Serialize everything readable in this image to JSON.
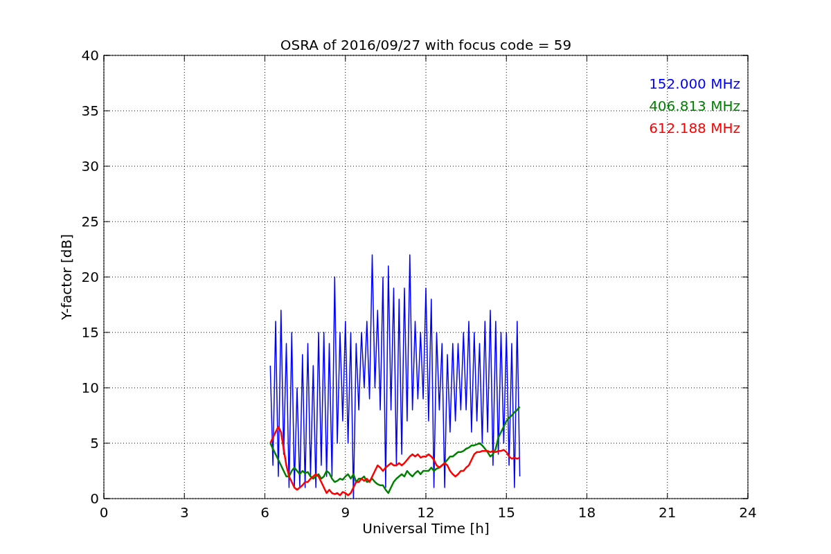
{
  "chart_data": {
    "type": "line",
    "title": "OSRA of 2016/09/27 with focus code = 59",
    "xlabel": "Universal Time [h]",
    "ylabel": "Y-factor [dB]",
    "grid": true,
    "xlim": [
      0,
      24
    ],
    "ylim": [
      0,
      40
    ],
    "xticks": [
      0,
      3,
      6,
      9,
      12,
      15,
      18,
      21,
      24
    ],
    "yticks": [
      0,
      5,
      10,
      15,
      20,
      25,
      30,
      35,
      40
    ],
    "x": [
      6.2,
      6.3,
      6.4,
      6.5,
      6.6,
      6.7,
      6.8,
      6.9,
      7.0,
      7.1,
      7.2,
      7.3,
      7.4,
      7.5,
      7.6,
      7.7,
      7.8,
      7.9,
      8.0,
      8.1,
      8.2,
      8.3,
      8.4,
      8.5,
      8.6,
      8.7,
      8.8,
      8.9,
      9.0,
      9.1,
      9.2,
      9.3,
      9.4,
      9.5,
      9.6,
      9.7,
      9.8,
      9.9,
      10.0,
      10.1,
      10.2,
      10.3,
      10.4,
      10.5,
      10.6,
      10.7,
      10.8,
      10.9,
      11.0,
      11.1,
      11.2,
      11.3,
      11.4,
      11.5,
      11.6,
      11.7,
      11.8,
      11.9,
      12.0,
      12.1,
      12.2,
      12.3,
      12.4,
      12.5,
      12.6,
      12.7,
      12.8,
      12.9,
      13.0,
      13.1,
      13.2,
      13.3,
      13.4,
      13.5,
      13.6,
      13.7,
      13.8,
      13.9,
      14.0,
      14.1,
      14.2,
      14.3,
      14.4,
      14.5,
      14.6,
      14.7,
      14.8,
      14.9,
      15.0,
      15.1,
      15.2,
      15.3,
      15.4,
      15.5
    ],
    "series": [
      {
        "name": "152.000 MHz",
        "color": "#0000ff",
        "values": [
          12,
          3,
          16,
          2,
          17,
          4,
          14,
          1,
          15,
          1,
          10,
          1,
          13,
          1,
          14,
          2,
          12,
          1,
          15,
          3,
          15,
          2,
          14,
          2,
          20,
          5,
          15,
          7,
          16,
          5,
          15,
          0,
          14,
          8,
          15,
          10,
          16,
          9,
          22,
          10,
          17,
          8,
          20,
          1,
          21,
          8,
          19,
          3,
          18,
          4,
          19,
          7,
          22,
          8,
          16,
          9,
          15,
          9,
          19,
          7,
          18,
          1,
          15,
          8,
          14,
          1,
          13,
          6,
          14,
          7,
          14,
          8,
          15,
          8,
          16,
          6,
          15,
          7,
          14,
          5,
          16,
          6,
          17,
          3,
          16,
          4,
          15,
          5,
          15,
          3,
          14,
          1,
          16,
          2
        ]
      },
      {
        "name": "406.813 MHz",
        "color": "#008000",
        "values": [
          5,
          4.5,
          4,
          3.5,
          3,
          2.5,
          2,
          2,
          2.5,
          2.8,
          2.5,
          2.2,
          2.5,
          2.3,
          2.4,
          2,
          1.8,
          2,
          2.2,
          1.8,
          2,
          2.5,
          2.3,
          1.8,
          1.5,
          1.6,
          1.8,
          1.7,
          2,
          2.2,
          1.8,
          2.2,
          1.5,
          1.8,
          1.8,
          2,
          1.5,
          1.6,
          1.8,
          1.5,
          1.3,
          1.2,
          1.2,
          0.8,
          0.5,
          1.0,
          1.5,
          1.8,
          2,
          2.2,
          2,
          2.5,
          2.2,
          2,
          2.3,
          2.5,
          2.2,
          2.5,
          2.5,
          2.5,
          2.8,
          2.5,
          2.7,
          2.8,
          3,
          3.2,
          3.5,
          3.8,
          3.8,
          4,
          4.2,
          4.2,
          4.3,
          4.5,
          4.6,
          4.8,
          4.8,
          4.9,
          5,
          4.8,
          4.5,
          4.2,
          3.8,
          4,
          4.5,
          5.5,
          6,
          6.5,
          7,
          7.3,
          7.5,
          7.8,
          8,
          8.3
        ]
      },
      {
        "name": "612.188 MHz",
        "color": "#ff0000",
        "values": [
          5,
          5.5,
          6,
          6.5,
          6,
          4.5,
          3,
          2,
          1.5,
          1,
          0.8,
          1,
          1.2,
          1.5,
          1.5,
          1.8,
          2,
          2.2,
          2,
          1.5,
          1,
          0.5,
          0.8,
          0.5,
          0.4,
          0.5,
          0.3,
          0.6,
          0.5,
          0.3,
          0.5,
          1,
          1.5,
          1.5,
          1.8,
          1.6,
          1.8,
          1.5,
          2,
          2.5,
          3,
          2.8,
          2.5,
          2.8,
          3,
          3.2,
          3,
          3,
          3.2,
          3,
          3.2,
          3.5,
          3.8,
          4,
          3.8,
          4,
          3.7,
          3.8,
          3.8,
          4,
          3.8,
          3.5,
          3,
          2.8,
          3,
          3.2,
          3,
          2.5,
          2.2,
          2,
          2.2,
          2.5,
          2.5,
          2.8,
          3,
          3.5,
          4,
          4.2,
          4.2,
          4.3,
          4.3,
          4.3,
          4.2,
          4.3,
          4.2,
          4.3,
          4.3,
          4.4,
          4.2,
          3.8,
          3.6,
          3.7,
          3.6,
          3.7
        ]
      }
    ]
  }
}
